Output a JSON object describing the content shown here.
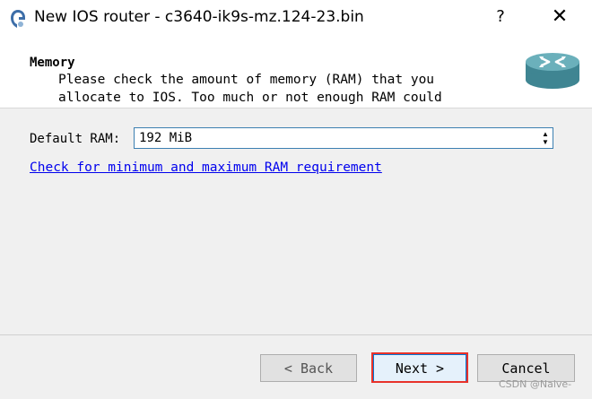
{
  "window": {
    "title": "New IOS router - c3640-ik9s-mz.124-23.bin",
    "help_label": "?",
    "close_label": "✕",
    "app_icon": "gns3-icon"
  },
  "header": {
    "title": "Memory",
    "description": "Please check the amount of memory (RAM) that you allocate to IOS. Too much or not enough RAM could",
    "logo_icon": "router-icon"
  },
  "form": {
    "ram_label": "Default RAM:",
    "ram_value": "192 MiB",
    "link_text": "Check for minimum and maximum RAM requirement"
  },
  "buttons": {
    "back": "< Back",
    "next": "Next >",
    "cancel": "Cancel"
  },
  "watermark": "CSDN @Naive-",
  "colors": {
    "link": "#0000ee",
    "focus_border": "#0078d7",
    "highlight": "#e8322a",
    "router_teal": "#4e9aa6"
  }
}
